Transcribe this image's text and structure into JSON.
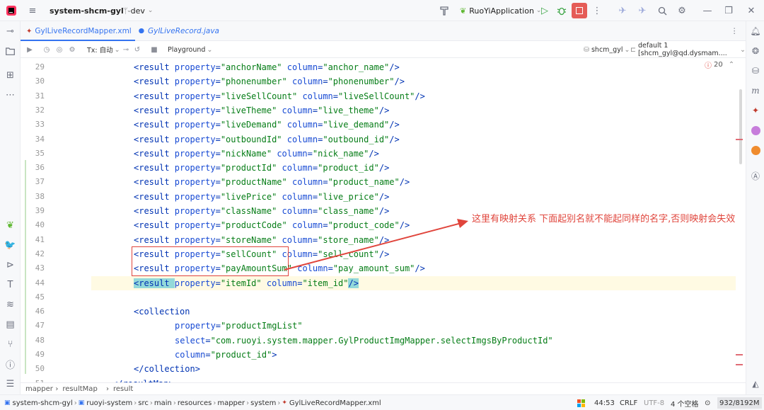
{
  "titlebar": {
    "project": "system-shcm-gyl",
    "branch": "dev",
    "run_config": "RuoYiApplication"
  },
  "tabs": [
    {
      "label": "GylLiveRecordMapper.xml",
      "active": true
    },
    {
      "label": "GylLiveRecord.java",
      "active": false
    }
  ],
  "dbtoolbar": {
    "tx": "Tx: 自动",
    "playground": "Playground",
    "schema": "shcm_gyl",
    "datasource": "default 1 [shcm_gyl@qd.dysmam...."
  },
  "inspections": {
    "count": "20"
  },
  "editor": {
    "lines": [
      {
        "n": "29",
        "indent": 1,
        "parts": [
          [
            "tag",
            "<result "
          ],
          [
            "attr",
            "property"
          ],
          [
            "punct",
            "="
          ],
          [
            "val",
            "\"anchorName\""
          ],
          [
            "punct",
            " "
          ],
          [
            "attr",
            "column"
          ],
          [
            "punct",
            "="
          ],
          [
            "val",
            "\"anchor_name\""
          ],
          [
            "tag",
            "/>"
          ]
        ]
      },
      {
        "n": "30",
        "indent": 1,
        "parts": [
          [
            "tag",
            "<result "
          ],
          [
            "attr",
            "property"
          ],
          [
            "punct",
            "="
          ],
          [
            "val",
            "\"phonenumber\""
          ],
          [
            "punct",
            " "
          ],
          [
            "attr",
            "column"
          ],
          [
            "punct",
            "="
          ],
          [
            "val",
            "\"phonenumber\""
          ],
          [
            "tag",
            "/>"
          ]
        ]
      },
      {
        "n": "31",
        "indent": 1,
        "parts": [
          [
            "tag",
            "<result "
          ],
          [
            "attr",
            "property"
          ],
          [
            "punct",
            "="
          ],
          [
            "val",
            "\"liveSellCount\""
          ],
          [
            "punct",
            " "
          ],
          [
            "attr",
            "column"
          ],
          [
            "punct",
            "="
          ],
          [
            "val",
            "\"liveSellCount\""
          ],
          [
            "tag",
            "/>"
          ]
        ]
      },
      {
        "n": "32",
        "indent": 1,
        "parts": [
          [
            "tag",
            "<result "
          ],
          [
            "attr",
            "property"
          ],
          [
            "punct",
            "="
          ],
          [
            "val",
            "\"liveTheme\""
          ],
          [
            "punct",
            " "
          ],
          [
            "attr",
            "column"
          ],
          [
            "punct",
            "="
          ],
          [
            "val",
            "\"live_theme\""
          ],
          [
            "tag",
            "/>"
          ]
        ]
      },
      {
        "n": "33",
        "indent": 1,
        "parts": [
          [
            "tag",
            "<result "
          ],
          [
            "attr",
            "property"
          ],
          [
            "punct",
            "="
          ],
          [
            "val",
            "\"liveDemand\""
          ],
          [
            "punct",
            " "
          ],
          [
            "attr",
            "column"
          ],
          [
            "punct",
            "="
          ],
          [
            "val",
            "\"live_demand\""
          ],
          [
            "tag",
            "/>"
          ]
        ]
      },
      {
        "n": "34",
        "indent": 1,
        "parts": [
          [
            "tag",
            "<result "
          ],
          [
            "attr",
            "property"
          ],
          [
            "punct",
            "="
          ],
          [
            "val",
            "\"outboundId\""
          ],
          [
            "punct",
            " "
          ],
          [
            "attr",
            "column"
          ],
          [
            "punct",
            "="
          ],
          [
            "val",
            "\"outbound_id\""
          ],
          [
            "tag",
            "/>"
          ]
        ]
      },
      {
        "n": "35",
        "indent": 1,
        "parts": [
          [
            "tag",
            "<result "
          ],
          [
            "attr",
            "property"
          ],
          [
            "punct",
            "="
          ],
          [
            "val",
            "\"nickName\""
          ],
          [
            "punct",
            " "
          ],
          [
            "attr",
            "column"
          ],
          [
            "punct",
            "="
          ],
          [
            "val",
            "\"nick_name\""
          ],
          [
            "tag",
            "/>"
          ]
        ]
      },
      {
        "n": "36",
        "indent": 1,
        "parts": [
          [
            "tag",
            "<result "
          ],
          [
            "attr",
            "property"
          ],
          [
            "punct",
            "="
          ],
          [
            "val",
            "\"productId\""
          ],
          [
            "punct",
            " "
          ],
          [
            "attr",
            "column"
          ],
          [
            "punct",
            "="
          ],
          [
            "val",
            "\"product_id\""
          ],
          [
            "tag",
            "/>"
          ]
        ]
      },
      {
        "n": "37",
        "indent": 1,
        "parts": [
          [
            "tag",
            "<result "
          ],
          [
            "attr",
            "property"
          ],
          [
            "punct",
            "="
          ],
          [
            "val",
            "\"productName\""
          ],
          [
            "punct",
            " "
          ],
          [
            "attr",
            "column"
          ],
          [
            "punct",
            "="
          ],
          [
            "val",
            "\"product_name\""
          ],
          [
            "tag",
            "/>"
          ]
        ]
      },
      {
        "n": "38",
        "indent": 1,
        "parts": [
          [
            "tag",
            "<result "
          ],
          [
            "attr",
            "property"
          ],
          [
            "punct",
            "="
          ],
          [
            "val",
            "\"livePrice\""
          ],
          [
            "punct",
            " "
          ],
          [
            "attr",
            "column"
          ],
          [
            "punct",
            "="
          ],
          [
            "val",
            "\"live_price\""
          ],
          [
            "tag",
            "/>"
          ]
        ]
      },
      {
        "n": "39",
        "indent": 1,
        "parts": [
          [
            "tag",
            "<result "
          ],
          [
            "attr",
            "property"
          ],
          [
            "punct",
            "="
          ],
          [
            "val",
            "\"className\""
          ],
          [
            "punct",
            " "
          ],
          [
            "attr",
            "column"
          ],
          [
            "punct",
            "="
          ],
          [
            "val",
            "\"class_name\""
          ],
          [
            "tag",
            "/>"
          ]
        ]
      },
      {
        "n": "40",
        "indent": 1,
        "parts": [
          [
            "tag",
            "<result "
          ],
          [
            "attr",
            "property"
          ],
          [
            "punct",
            "="
          ],
          [
            "val",
            "\"productCode\""
          ],
          [
            "punct",
            " "
          ],
          [
            "attr",
            "column"
          ],
          [
            "punct",
            "="
          ],
          [
            "val",
            "\"product_code\""
          ],
          [
            "tag",
            "/>"
          ]
        ]
      },
      {
        "n": "41",
        "indent": 1,
        "parts": [
          [
            "tag",
            "<result "
          ],
          [
            "attr",
            "property"
          ],
          [
            "punct",
            "="
          ],
          [
            "val",
            "\"storeName\""
          ],
          [
            "punct",
            " "
          ],
          [
            "attr",
            "column"
          ],
          [
            "punct",
            "="
          ],
          [
            "val",
            "\"store_name\""
          ],
          [
            "tag",
            "/>"
          ]
        ]
      },
      {
        "n": "42",
        "indent": 1,
        "parts": [
          [
            "tag",
            "<result "
          ],
          [
            "attr",
            "property"
          ],
          [
            "punct",
            "="
          ],
          [
            "val",
            "\"sellCount\""
          ],
          [
            "punct",
            " "
          ],
          [
            "attr",
            "column"
          ],
          [
            "punct",
            "="
          ],
          [
            "val",
            "\"sell_count\""
          ],
          [
            "tag",
            "/>"
          ]
        ]
      },
      {
        "n": "43",
        "indent": 1,
        "parts": [
          [
            "tag",
            "<result "
          ],
          [
            "attr",
            "property"
          ],
          [
            "punct",
            "="
          ],
          [
            "val",
            "\"payAmountSum\""
          ],
          [
            "punct",
            " "
          ],
          [
            "attr",
            "column"
          ],
          [
            "punct",
            "="
          ],
          [
            "val",
            "\"pay_amount_sum\""
          ],
          [
            "tag",
            "/>"
          ]
        ]
      },
      {
        "n": "44",
        "indent": 1,
        "highlight": true,
        "parts": [
          [
            "tag",
            "<result "
          ],
          [
            "attr",
            "property"
          ],
          [
            "punct",
            "="
          ],
          [
            "val",
            "\"itemId\""
          ],
          [
            "punct",
            " "
          ],
          [
            "attr",
            "column"
          ],
          [
            "punct",
            "="
          ],
          [
            "val",
            "\"item_id\""
          ],
          [
            "tag",
            "/>"
          ]
        ]
      },
      {
        "n": "45",
        "indent": 0,
        "parts": []
      },
      {
        "n": "46",
        "indent": 1,
        "parts": [
          [
            "tag",
            "<collection"
          ]
        ]
      },
      {
        "n": "47",
        "indent": 2,
        "parts": [
          [
            "attr",
            "property"
          ],
          [
            "punct",
            "="
          ],
          [
            "val",
            "\"productImgList\""
          ]
        ]
      },
      {
        "n": "48",
        "indent": 2,
        "parts": [
          [
            "attr",
            "select"
          ],
          [
            "punct",
            "="
          ],
          [
            "val",
            "\"com.ruoyi.system.mapper.GylProductImgMapper.selectImgsByProductId\""
          ]
        ]
      },
      {
        "n": "49",
        "indent": 2,
        "parts": [
          [
            "attr",
            "column"
          ],
          [
            "punct",
            "="
          ],
          [
            "val",
            "\"product_id\""
          ],
          [
            "tag",
            ">"
          ]
        ]
      },
      {
        "n": "50",
        "indent": 1,
        "parts": [
          [
            "tag",
            "</collection>"
          ]
        ]
      },
      {
        "n": "51",
        "indent": 0,
        "parts": [
          [
            "tag",
            "</resultMap>"
          ]
        ]
      }
    ]
  },
  "annotation": {
    "text": "这里有映射关系  下面起别名就不能起同样的名字,否则映射会失效",
    "color": "#e0453c"
  },
  "breadcrumb": [
    "mapper",
    "resultMap",
    "result"
  ],
  "statusbar": {
    "path": [
      "system-shcm-gyl",
      "ruoyi-system",
      "src",
      "main",
      "resources",
      "mapper",
      "system",
      "GylLiveRecordMapper.xml"
    ],
    "position": "44:53",
    "line_sep": "CRLF",
    "encoding": "UTF-8",
    "indent": "4 个空格",
    "memory": "932/8192M"
  }
}
